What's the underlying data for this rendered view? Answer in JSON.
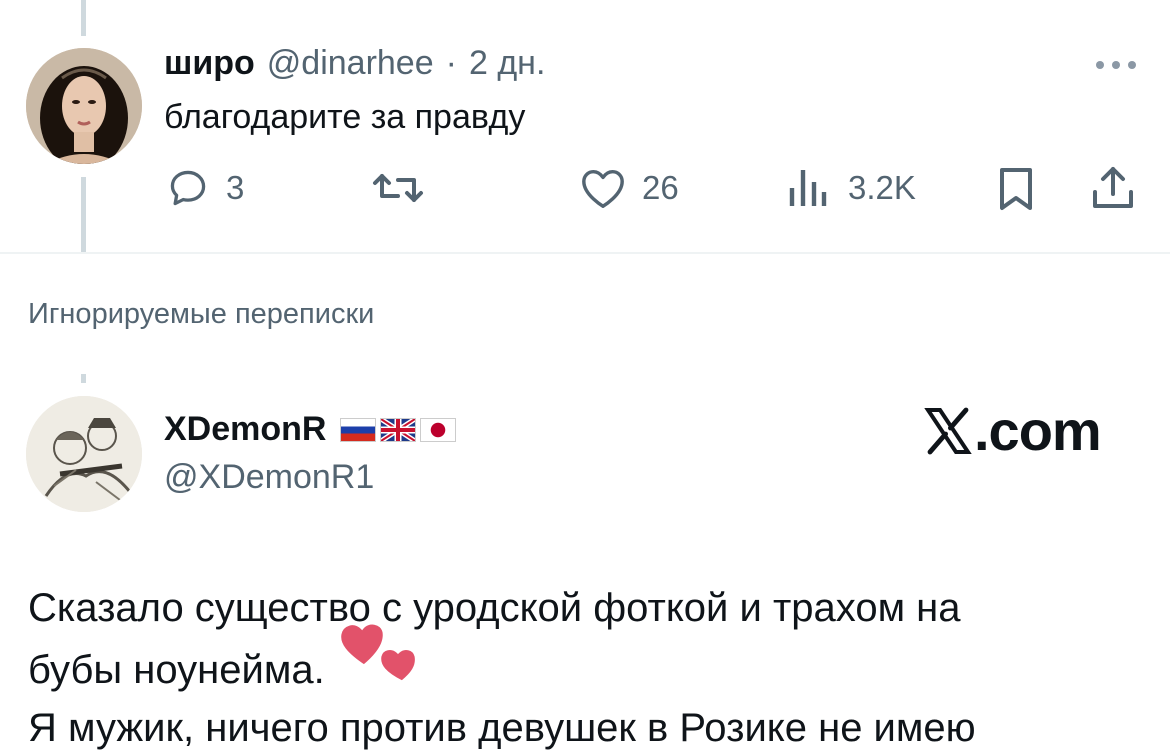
{
  "reply": {
    "display_name": "широ",
    "handle": "@dinarhee",
    "separator": "·",
    "time": "2 дн.",
    "text": "благодарите за правду",
    "more_icon": "more-icon",
    "stats": {
      "replies": "3",
      "likes": "26",
      "views": "3.2K"
    }
  },
  "section": {
    "ignored_label": "Игнорируемые переписки"
  },
  "post": {
    "display_name": "XDemonR",
    "flags": [
      "russia-flag",
      "uk-flag",
      "japan-flag"
    ],
    "handle": "@XDemonR1",
    "logo_text": ".com",
    "text_line1": "Сказало существо с уродской фоткой и трахом на",
    "text_line2": "бубы ноунейма.",
    "text_line3": "Я мужик, ничего против девушек в Розике не имею"
  },
  "colors": {
    "text": "#0f1419",
    "muted": "#536471",
    "divider": "#eff3f4",
    "heart_sticker": "#e2526a"
  }
}
